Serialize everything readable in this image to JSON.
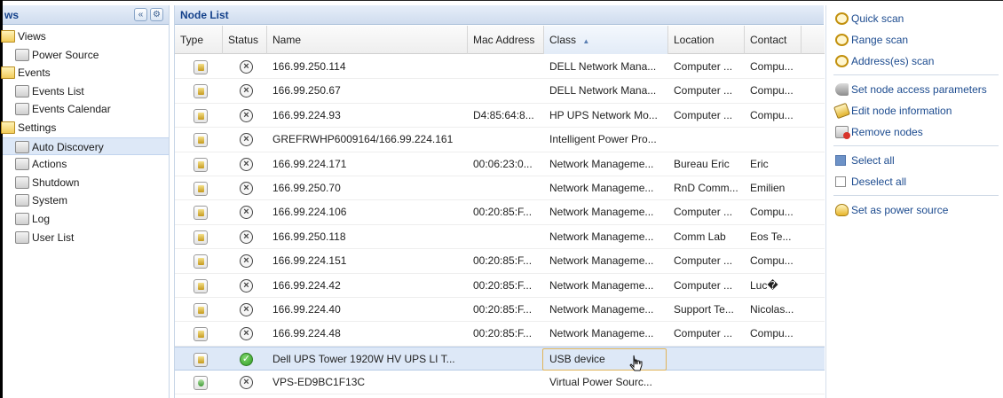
{
  "left_panel": {
    "title": "ws",
    "collapse_icon": "double-chevron-left-icon",
    "settings_icon": "gear-icon",
    "tree": [
      {
        "label": "Views",
        "icon": "folder-icon",
        "level": 0
      },
      {
        "label": "Power Source",
        "icon": "power-source-icon",
        "level": 1
      },
      {
        "label": "Events",
        "icon": "folder-icon",
        "level": 0
      },
      {
        "label": "Events List",
        "icon": "events-list-icon",
        "level": 1
      },
      {
        "label": "Events Calendar",
        "icon": "events-calendar-icon",
        "level": 1
      },
      {
        "label": "Settings",
        "icon": "folder-icon",
        "level": 0
      },
      {
        "label": "Auto Discovery",
        "icon": "auto-discovery-icon",
        "level": 1,
        "selected": true
      },
      {
        "label": "Actions",
        "icon": "actions-icon",
        "level": 1
      },
      {
        "label": "Shutdown",
        "icon": "shutdown-icon",
        "level": 1
      },
      {
        "label": "System",
        "icon": "system-icon",
        "level": 1
      },
      {
        "label": "Log",
        "icon": "log-icon",
        "level": 1
      },
      {
        "label": "User List",
        "icon": "user-list-icon",
        "level": 1
      }
    ]
  },
  "node_list": {
    "title": "Node List",
    "columns": {
      "type": "Type",
      "status": "Status",
      "name": "Name",
      "mac": "Mac Address",
      "class": "Class",
      "location": "Location",
      "contact": "Contact"
    },
    "sort": {
      "column": "class",
      "direction": "ascending"
    },
    "rows": [
      {
        "type": "ups",
        "status": "error",
        "name": "166.99.250.114",
        "mac": "",
        "class": "DELL Network Mana...",
        "location": "Computer ...",
        "contact": "Compu..."
      },
      {
        "type": "ups",
        "status": "error",
        "name": "166.99.250.67",
        "mac": "",
        "class": "DELL Network Mana...",
        "location": "Computer ...",
        "contact": "Compu..."
      },
      {
        "type": "ups",
        "status": "error",
        "name": "166.99.224.93",
        "mac": "D4:85:64:8...",
        "class": "HP UPS Network Mo...",
        "location": "Computer ...",
        "contact": "Compu..."
      },
      {
        "type": "ups",
        "status": "error",
        "name": "GREFRWHP6009164/166.99.224.161",
        "mac": "",
        "class": "Intelligent Power Pro...",
        "location": "",
        "contact": ""
      },
      {
        "type": "ups",
        "status": "error",
        "name": "166.99.224.171",
        "mac": "00:06:23:0...",
        "class": "Network Manageme...",
        "location": "Bureau Eric",
        "contact": "Eric"
      },
      {
        "type": "ups",
        "status": "error",
        "name": "166.99.250.70",
        "mac": "",
        "class": "Network Manageme...",
        "location": "RnD Comm...",
        "contact": "Emilien"
      },
      {
        "type": "ups",
        "status": "error",
        "name": "166.99.224.106",
        "mac": "00:20:85:F...",
        "class": "Network Manageme...",
        "location": "Computer ...",
        "contact": "Compu..."
      },
      {
        "type": "ups",
        "status": "error",
        "name": "166.99.250.118",
        "mac": "",
        "class": "Network Manageme...",
        "location": "Comm Lab",
        "contact": "Eos Te..."
      },
      {
        "type": "ups",
        "status": "error",
        "name": "166.99.224.151",
        "mac": "00:20:85:F...",
        "class": "Network Manageme...",
        "location": "Computer ...",
        "contact": "Compu..."
      },
      {
        "type": "ups",
        "status": "error",
        "name": "166.99.224.42",
        "mac": "00:20:85:F...",
        "class": "Network Manageme...",
        "location": "Computer ...",
        "contact": "Luc�"
      },
      {
        "type": "ups",
        "status": "error",
        "name": "166.99.224.40",
        "mac": "00:20:85:F...",
        "class": "Network Manageme...",
        "location": "Support Te...",
        "contact": "Nicolas..."
      },
      {
        "type": "ups",
        "status": "error",
        "name": "166.99.224.48",
        "mac": "00:20:85:F...",
        "class": "Network Manageme...",
        "location": "Computer ...",
        "contact": "Compu..."
      },
      {
        "type": "ups",
        "status": "ok",
        "name": "Dell UPS Tower 1920W HV UPS LI T...",
        "mac": "",
        "class": "USB device",
        "location": "",
        "contact": "",
        "selected": true
      },
      {
        "type": "vps",
        "status": "error",
        "name": "VPS-ED9BC1F13C",
        "mac": "",
        "class": "Virtual Power Sourc...",
        "location": "",
        "contact": ""
      }
    ]
  },
  "actions_panel": {
    "groups": [
      [
        {
          "label": "Quick scan",
          "icon": "quick-scan-icon"
        },
        {
          "label": "Range scan",
          "icon": "range-scan-icon"
        },
        {
          "label": "Address(es) scan",
          "icon": "address-scan-icon"
        }
      ],
      [
        {
          "label": "Set node access parameters",
          "icon": "key-icon"
        },
        {
          "label": "Edit node information",
          "icon": "edit-icon"
        },
        {
          "label": "Remove nodes",
          "icon": "remove-icon"
        }
      ],
      [
        {
          "label": "Select all",
          "icon": "select-all-icon"
        },
        {
          "label": "Deselect all",
          "icon": "deselect-all-icon"
        }
      ],
      [
        {
          "label": "Set as power source",
          "icon": "power-source-icon"
        }
      ]
    ]
  }
}
